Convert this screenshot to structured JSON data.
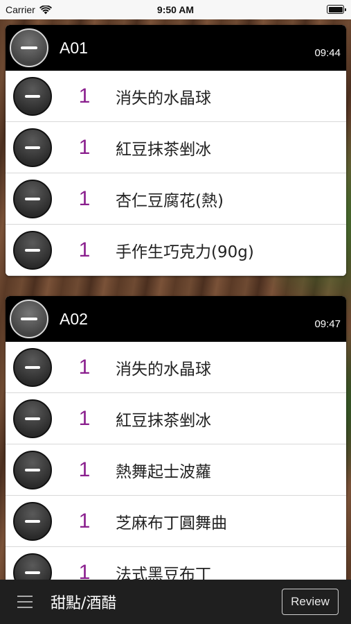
{
  "status_bar": {
    "carrier": "Carrier",
    "time": "9:50 AM",
    "icons": [
      "wifi-icon",
      "battery-icon"
    ]
  },
  "orders": [
    {
      "table": "A01",
      "time": "09:44",
      "items": [
        {
          "qty": "1",
          "name": "消失的水晶球"
        },
        {
          "qty": "1",
          "name": "紅豆抹茶剉冰"
        },
        {
          "qty": "1",
          "name": "杏仁豆腐花(熱)"
        },
        {
          "qty": "1",
          "name": "手作生巧克力(90g)"
        }
      ]
    },
    {
      "table": "A02",
      "time": "09:47",
      "items": [
        {
          "qty": "1",
          "name": "消失的水晶球"
        },
        {
          "qty": "1",
          "name": "紅豆抹茶剉冰"
        },
        {
          "qty": "1",
          "name": "熱舞起士波蘿"
        },
        {
          "qty": "1",
          "name": "芝麻布丁圓舞曲"
        },
        {
          "qty": "1",
          "name": "法式黑豆布丁"
        }
      ]
    }
  ],
  "bottom_bar": {
    "title": "甜點/酒醋",
    "review_label": "Review",
    "menu_icon": "hamburger-menu-icon"
  },
  "colors": {
    "quantity": "#8a1f8e",
    "header_bg": "#000000",
    "bottom_bar_bg": "#1f1f1f"
  }
}
